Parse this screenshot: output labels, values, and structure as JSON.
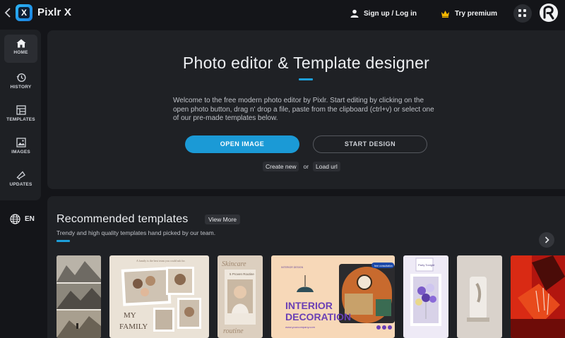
{
  "header": {
    "app_title": "Pixlr X",
    "signup_label": "Sign up / Log in",
    "premium_label": "Try premium"
  },
  "sidebar": {
    "items": [
      {
        "label": "HOME",
        "icon": "home-icon",
        "active": true
      },
      {
        "label": "HISTORY",
        "icon": "history-icon"
      },
      {
        "label": "TEMPLATES",
        "icon": "templates-icon"
      },
      {
        "label": "IMAGES",
        "icon": "images-icon"
      },
      {
        "label": "UPDATES",
        "icon": "updates-icon"
      }
    ],
    "language": "EN"
  },
  "hero": {
    "title": "Photo editor & Template designer",
    "description": "Welcome to the free modern photo editor by Pixlr. Start editing by clicking on the open photo button, drag n' drop a file, paste from the clipboard (ctrl+v) or select one of our pre-made templates below.",
    "open_image_label": "OPEN IMAGE",
    "start_design_label": "START DESIGN",
    "create_new_label": "Create new",
    "or_label": "or",
    "load_url_label": "Load url"
  },
  "recommended": {
    "title": "Recommended templates",
    "view_more_label": "View More",
    "subtitle": "Trendy and high quality templates hand picked by our team.",
    "templates": [
      {
        "texts": []
      },
      {
        "texts": [
          "A family is the best team you could ask for.",
          "MY",
          "FAMILY"
        ]
      },
      {
        "texts": [
          "Skincare",
          "5 Proven Routine",
          "routine"
        ]
      },
      {
        "texts": [
          "INTERIOR",
          "DECORATION",
          "free consultation",
          "INTERIOR DESIGN",
          "www.yourcompany.com"
        ]
      },
      {
        "texts": [
          "Party Tonight"
        ]
      },
      {
        "texts": []
      },
      {
        "texts": []
      }
    ]
  },
  "colors": {
    "accent": "#1b9ad6",
    "background": "#141519",
    "panel": "#1f2125",
    "premium_crown": "#f5b800"
  }
}
